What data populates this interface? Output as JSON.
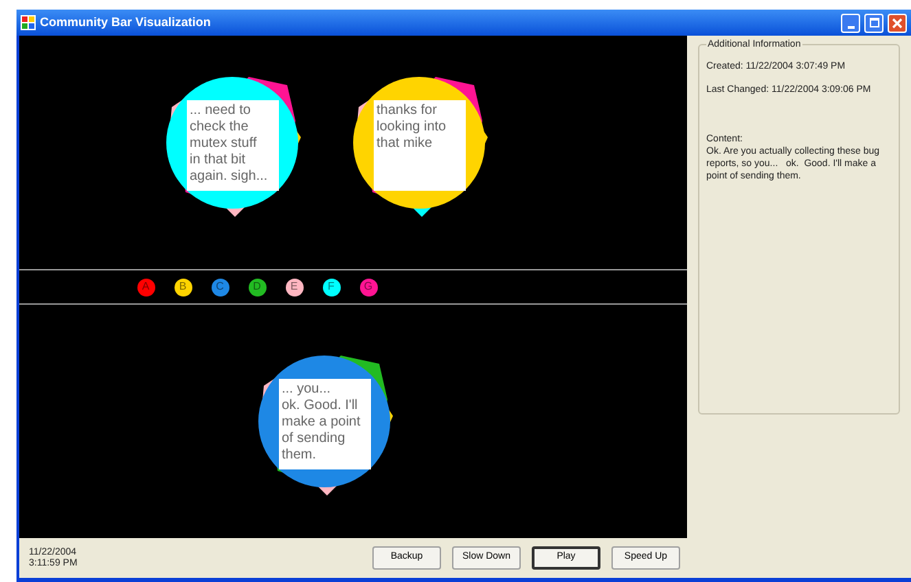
{
  "window": {
    "title": "Community Bar Visualization"
  },
  "top_bubbles": [
    {
      "color": "#00ffff",
      "text": "... need to check the mutex stuff in that bit again. sigh..."
    },
    {
      "color": "#ffd400",
      "text": "thanks for looking into that mike"
    }
  ],
  "legend": [
    {
      "letter": "A",
      "color": "#ff0000"
    },
    {
      "letter": "B",
      "color": "#ffd400"
    },
    {
      "letter": "C",
      "color": "#1e88e5"
    },
    {
      "letter": "D",
      "color": "#22bb22"
    },
    {
      "letter": "E",
      "color": "#ffb6c1"
    },
    {
      "letter": "F",
      "color": "#00ffff"
    },
    {
      "letter": "G",
      "color": "#ff1493"
    }
  ],
  "bottom_bubbles": [
    {
      "color": "#1e88e5",
      "text": "... you...\nok. Good. I'll make a point of sending them."
    }
  ],
  "info": {
    "title": "Additional Information",
    "created": "Created: 11/22/2004 3:07:49 PM",
    "last_changed": "Last Changed: 11/22/2004 3:09:06 PM",
    "content_label": "Content:",
    "content": "Ok. Are you actually collecting these bug reports, so you...   ok.  Good. I'll make a point of sending them."
  },
  "status": {
    "date": "11/22/2004",
    "time": "3:11:59 PM"
  },
  "buttons": [
    {
      "label": "Backup",
      "default": false
    },
    {
      "label": "Slow Down",
      "default": false
    },
    {
      "label": "Play",
      "default": true
    },
    {
      "label": "Speed Up",
      "default": false
    }
  ]
}
